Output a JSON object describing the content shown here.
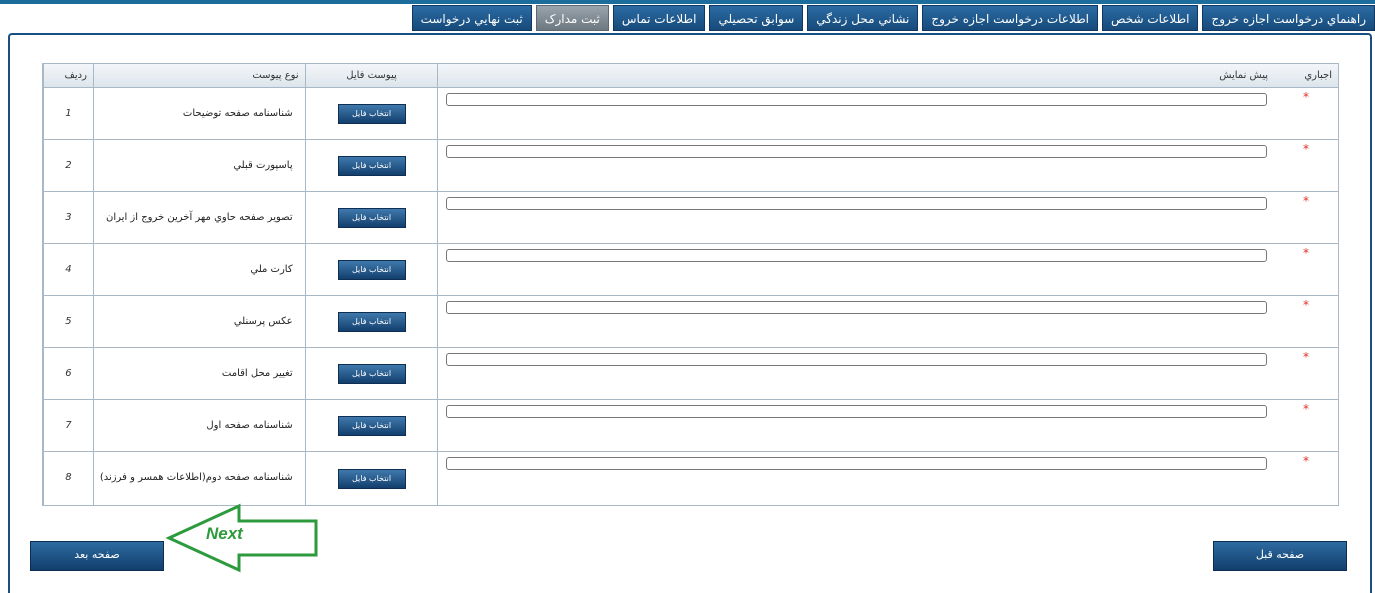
{
  "tabs": [
    {
      "label": "راهنماي درخواست اجازه خروج",
      "active": false
    },
    {
      "label": "اطلاعات شخص",
      "active": false
    },
    {
      "label": "اطلاعات درخواست اجازه خروج",
      "active": false
    },
    {
      "label": "نشاني محل زندگي",
      "active": false
    },
    {
      "label": "سوابق تحصيلي",
      "active": false
    },
    {
      "label": "اطلاعات تماس",
      "active": false
    },
    {
      "label": "ثبت مدارک",
      "active": true
    },
    {
      "label": "ثبت نهايي درخواست",
      "active": false
    }
  ],
  "table": {
    "headers": {
      "row": "رديف",
      "type": "نوع پيوست",
      "attach": "پيوست فايل",
      "preview": "پيش نمايش",
      "required": "اجباري"
    },
    "button_label": "انتخاب فايل",
    "required_mark": "*",
    "rows": [
      {
        "num": "1",
        "type": "شناسنامه صفحه توضيحات"
      },
      {
        "num": "2",
        "type": "پاسپورت قبلي"
      },
      {
        "num": "3",
        "type": "تصوير صفحه حاوي مهر آخرين خروج از ايران"
      },
      {
        "num": "4",
        "type": "کارت ملي"
      },
      {
        "num": "5",
        "type": "عکس پرسنلي"
      },
      {
        "num": "6",
        "type": "تغيير محل اقامت"
      },
      {
        "num": "7",
        "type": "شناسنامه صفحه اول"
      },
      {
        "num": "8",
        "type": "شناسنامه صفحه دوم(اطلاعات همسر و فرزند)"
      }
    ]
  },
  "nav": {
    "next_label": "صفحه بعد",
    "prev_label": "صفحه قبل",
    "annotation": "Next"
  },
  "colors": {
    "accent": "#1c6d9c",
    "button": "#164a7a",
    "required": "#e0302a",
    "arrow": "#2e9a3e"
  }
}
